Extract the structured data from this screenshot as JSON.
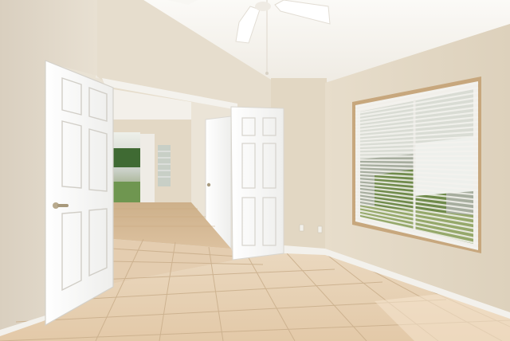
{
  "photo": {
    "subject": "",
    "palette": {
      "wall_left": "#e6decf",
      "wall_right": "#e4d9c6",
      "ceiling": "#f6f4ef",
      "door": "#fbfbfa",
      "trim": "#f3f1ec",
      "tile": "#e6cfb2",
      "grout": "#cdb494",
      "hall_floor": "#d8bf9d",
      "window_frame": "#c8a97f",
      "blind": "#f1f0ec",
      "exterior_green": "#6f8a4a",
      "outlet": "#f2f0ea"
    },
    "elements": {
      "ceiling_fan": "ceiling-fan-icon",
      "door_knob": "door-knob-icon",
      "window": "window-blinds-icon"
    }
  }
}
